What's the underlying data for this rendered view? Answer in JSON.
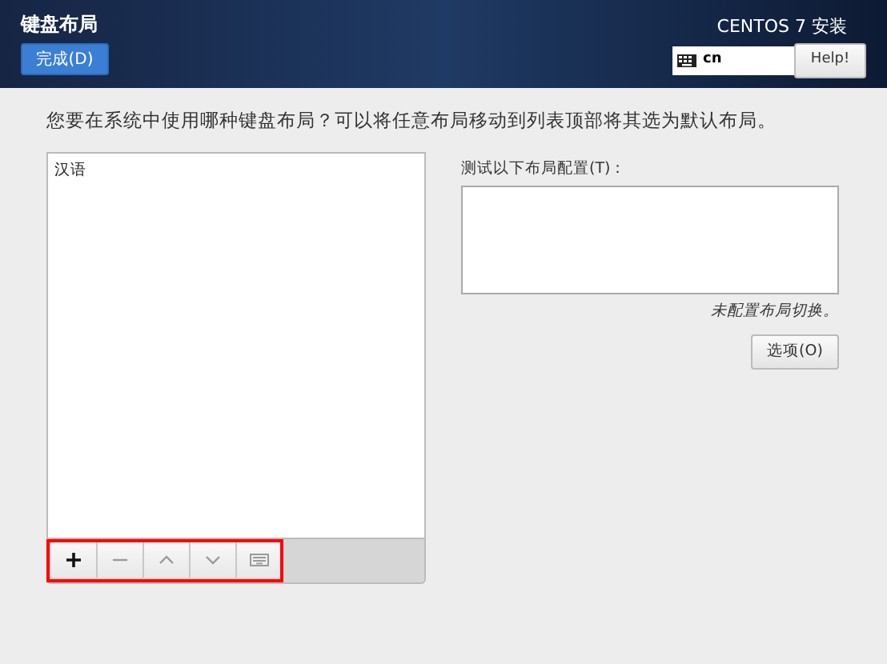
{
  "header": {
    "title": "键盘布局",
    "done_button": "完成(D)",
    "product": "CENTOS 7 安装",
    "keyboard_indicator": "cn",
    "help_button": "Help!"
  },
  "prompt": "您要在系统中使用哪种键盘布局？可以将任意布局移动到列表顶部将其选为默认布局。",
  "layouts": [
    {
      "label": "汉语",
      "selected": false
    }
  ],
  "toolbar": {
    "highlighted": true,
    "buttons": [
      {
        "kind": "add",
        "disabled": false
      },
      {
        "kind": "remove",
        "disabled": true
      },
      {
        "kind": "up",
        "disabled": true
      },
      {
        "kind": "down",
        "disabled": true
      },
      {
        "kind": "preview",
        "disabled": true
      }
    ]
  },
  "test_area": {
    "label": "测试以下布局配置(T)：",
    "note": "未配置布局切换。",
    "options_button": "选项(O)"
  }
}
